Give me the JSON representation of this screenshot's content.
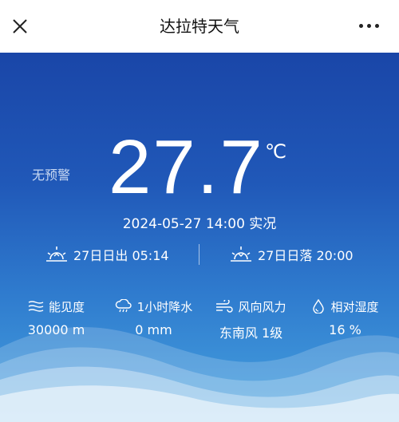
{
  "header": {
    "title": "达拉特天气",
    "close_icon": "close-icon",
    "more_icon": "more-horizontal-icon"
  },
  "weather": {
    "warning": "无预警",
    "temperature": "27.7",
    "unit": "℃",
    "observation": "2024-05-27 14:00 实况",
    "sunrise": "27日日出 05:14",
    "sunset": "27日日落 20:00"
  },
  "stats": [
    {
      "label": "能见度",
      "value": "30000 m",
      "icon": "visibility-icon"
    },
    {
      "label": "1小时降水",
      "value": "0 mm",
      "icon": "rain-cloud-icon"
    },
    {
      "label": "风向风力",
      "value": "东南风 1级",
      "icon": "wind-icon"
    },
    {
      "label": "相对湿度",
      "value": "16 %",
      "icon": "humidity-drop-icon"
    }
  ],
  "colors": {
    "panel_top": "#1a46a8",
    "panel_bottom": "#46a2df",
    "text": "#ffffff"
  }
}
